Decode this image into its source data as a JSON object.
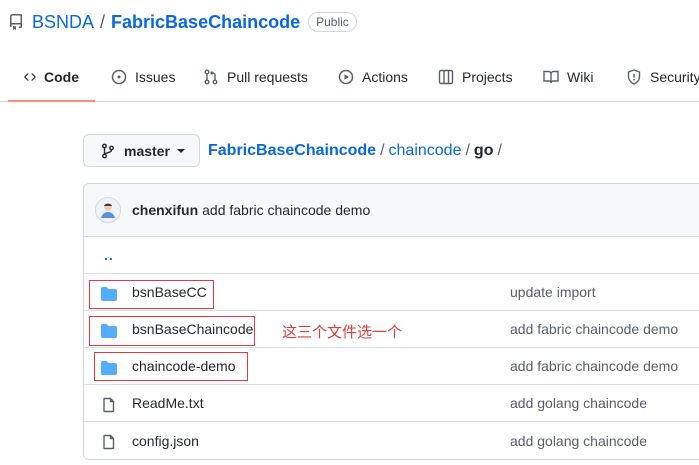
{
  "repo": {
    "owner": "BSNDA",
    "separator": "/",
    "name": "FabricBaseChaincode",
    "visibility": "Public",
    "icon": "repo-icon"
  },
  "tabs": [
    {
      "label": "Code",
      "icon": "code-icon",
      "active": true
    },
    {
      "label": "Issues",
      "icon": "issue-icon"
    },
    {
      "label": "Pull requests",
      "icon": "pull-request-icon"
    },
    {
      "label": "Actions",
      "icon": "play-icon"
    },
    {
      "label": "Projects",
      "icon": "table-icon"
    },
    {
      "label": "Wiki",
      "icon": "book-icon"
    },
    {
      "label": "Security",
      "icon": "shield-icon"
    }
  ],
  "branch": {
    "name": "master",
    "icon": "git-branch-icon"
  },
  "breadcrumb": {
    "repo": "FabricBaseChaincode",
    "seg1": "chaincode",
    "current": "go",
    "slash": "/"
  },
  "commit": {
    "author": "chenxifun",
    "message": "add fabric chaincode demo"
  },
  "parent_link": "..",
  "files": [
    {
      "name": "bsnBaseCC",
      "type": "folder",
      "message": "update import"
    },
    {
      "name": "bsnBaseChaincode",
      "type": "folder",
      "message": "add fabric chaincode demo"
    },
    {
      "name": "chaincode-demo",
      "type": "folder",
      "message": "add fabric chaincode demo"
    },
    {
      "name": "ReadMe.txt",
      "type": "file",
      "message": "add golang chaincode"
    },
    {
      "name": "config.json",
      "type": "file",
      "message": "add golang chaincode"
    }
  ],
  "annotation": {
    "text": "这三个文件选一个",
    "color": "#e23b3b"
  },
  "colors": {
    "link": "#0969da",
    "folder": "#54aeff",
    "active_tab": "#fd8c73"
  }
}
